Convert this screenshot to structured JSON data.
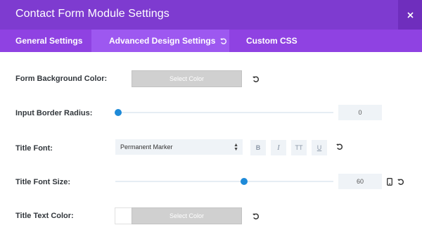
{
  "modal": {
    "title": "Contact Form Module Settings",
    "close_icon": "close-icon"
  },
  "tabs": [
    {
      "label": "General Settings",
      "active": false
    },
    {
      "label": "Advanced Design Settings",
      "active": true,
      "icon": "refresh-icon"
    },
    {
      "label": "Custom CSS",
      "active": false
    }
  ],
  "fields": {
    "form_bg": {
      "label": "Form Background Color:",
      "button": "Select Color"
    },
    "border_radius": {
      "label": "Input Border Radius:",
      "value": "0",
      "slider_fraction": 0
    },
    "title_font": {
      "label": "Title Font:",
      "selected": "Permanent Marker",
      "styles": [
        "B",
        "I",
        "TT",
        "U"
      ]
    },
    "title_font_size": {
      "label": "Title Font Size:",
      "value": "60",
      "slider_fraction": 0.6
    },
    "title_text_color": {
      "label": "Title Text Color:",
      "button": "Select Color"
    }
  },
  "colors": {
    "header": "#7e3bd0",
    "tabs": "#8f42e2",
    "active_tab": "#9d58f0",
    "slider_thumb": "#1e8ad8"
  }
}
